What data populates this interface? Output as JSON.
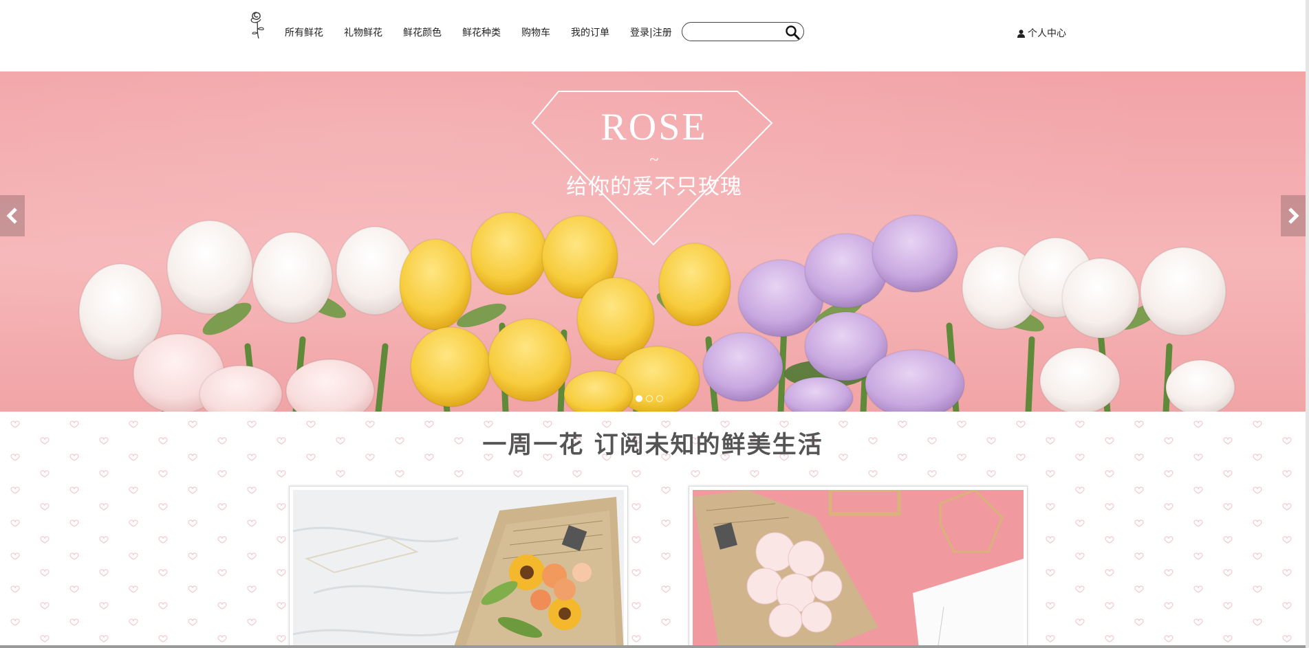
{
  "header": {
    "nav": [
      "所有鲜花",
      "礼物鲜花",
      "鲜花颜色",
      "鲜花种类",
      "购物车",
      "我的订单",
      "登录|注册"
    ],
    "search": {
      "value": "",
      "placeholder": ""
    },
    "user_center": "个人中心"
  },
  "banner": {
    "title": "ROSE",
    "tilde": "~",
    "subtitle": "给你的爱不只玫瑰",
    "active_slide": 1,
    "slide_count": 3
  },
  "section": {
    "title": "一周一花  订阅未知的鲜美生活"
  },
  "colors": {
    "banner_pink": "#f4aeb1",
    "heart_pattern": "#f3c6cc",
    "title_gray": "#555555"
  },
  "icons": {
    "logo": "rose-logo-icon",
    "search": "search-icon",
    "user": "user-icon",
    "prev": "chevron-left-icon",
    "next": "chevron-right-icon"
  }
}
